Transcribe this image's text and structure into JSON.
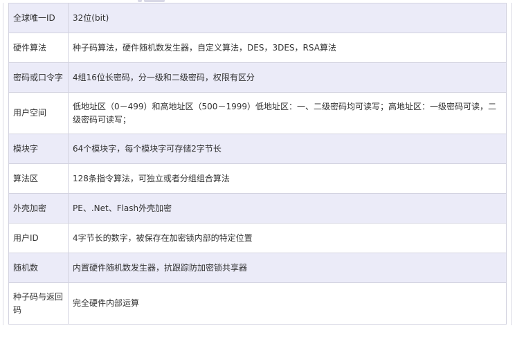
{
  "colors": {
    "row_shaded": "#ebebf8",
    "row_plain": "#ffffff",
    "border": "#d3d3e0",
    "text": "#333333"
  },
  "spec_table": {
    "rows": [
      {
        "label": "全球唯一ID",
        "value": "32位(bit)"
      },
      {
        "label": "硬件算法",
        "value": "种子码算法，硬件随机数发生器，自定义算法，DES，3DES，RSA算法"
      },
      {
        "label": "密码或口令字",
        "value": "4组16位长密码，分一级和二级密码，权限有区分"
      },
      {
        "label": "用户空间",
        "value": "低地址区（0－499）和高地址区（500－1999）低地址区：一、二级密码均可读写；高地址区：一级密码可读，二级密码可读写；"
      },
      {
        "label": "模块字",
        "value": "64个模块字，每个模块字可存储2字节长"
      },
      {
        "label": "算法区",
        "value": "128条指令算法，可独立或者分组组合算法"
      },
      {
        "label": "外壳加密",
        "value": "PE、.Net、Flash外壳加密"
      },
      {
        "label": "用户ID",
        "value": "4字节长的数字，被保存在加密锁内部的特定位置"
      },
      {
        "label": "随机数",
        "value": "内置硬件随机数发生器，抗跟踪防加密锁共享器"
      },
      {
        "label": "种子码与返回码",
        "value": "完全硬件内部运算"
      }
    ]
  }
}
